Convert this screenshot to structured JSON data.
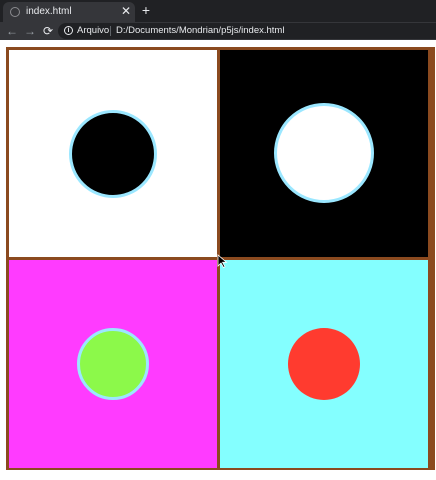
{
  "tab": {
    "title": "index.html",
    "close_glyph": "✕",
    "favicon_icon": "globe-icon"
  },
  "new_tab_glyph": "+",
  "toolbar": {
    "back_glyph": "←",
    "forward_glyph": "→",
    "reload_glyph": "⟳",
    "info_glyph": "i",
    "site_label": "Arquivo",
    "url": "D:/Documents/Mondrian/p5js/index.html"
  },
  "colors": {
    "frame": "#8b4a1f",
    "outline": "#9be7ff",
    "cell_tl_bg": "#ffffff",
    "cell_tl_circle": "#000000",
    "cell_tr_bg": "#000000",
    "cell_tr_circle": "#ffffff",
    "cell_bl_bg": "#ff3bff",
    "cell_bl_circle": "#8cf94a",
    "cell_br_bg": "#84ffff",
    "cell_br_circle": "#ff3b2f"
  }
}
